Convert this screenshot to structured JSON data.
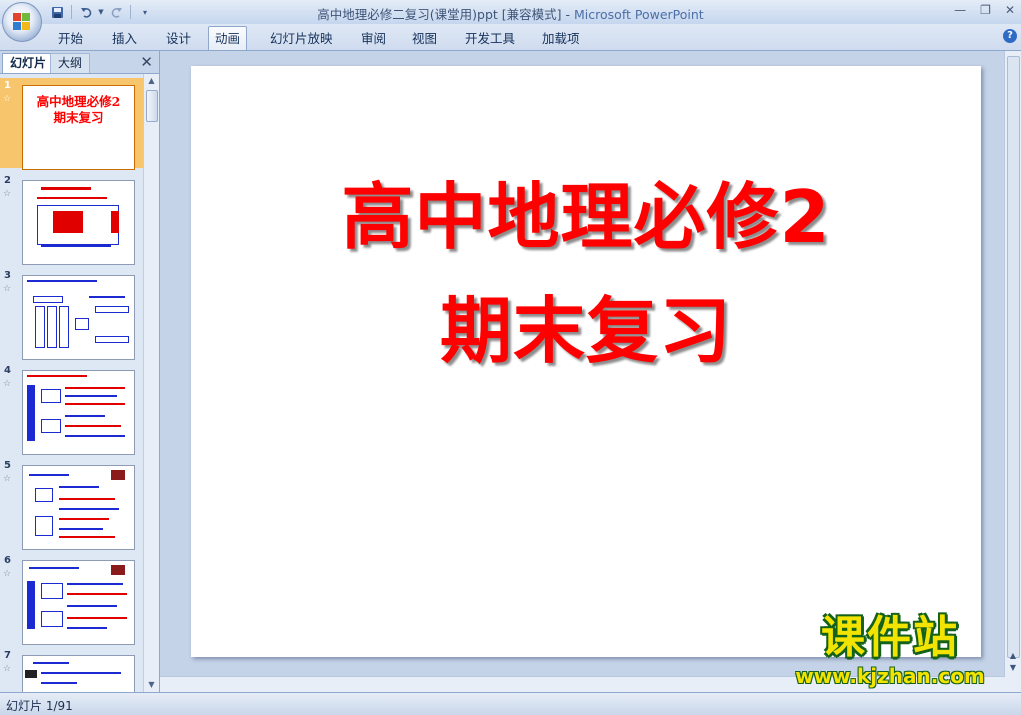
{
  "window": {
    "title": "高中地理必修二复习(课堂用)ppt [兼容模式]",
    "app_name": "Microsoft PowerPoint",
    "separator": " - "
  },
  "quick_access": {
    "icons": [
      "save-icon",
      "undo-icon",
      "redo-icon",
      "customize-icon"
    ]
  },
  "ribbon": {
    "tabs": [
      {
        "label": "开始"
      },
      {
        "label": "插入"
      },
      {
        "label": "设计"
      },
      {
        "label": "动画"
      },
      {
        "label": "幻灯片放映"
      },
      {
        "label": "审阅"
      },
      {
        "label": "视图"
      },
      {
        "label": "开发工具"
      },
      {
        "label": "加载项"
      }
    ],
    "active_tab": "动画",
    "help_label": "?"
  },
  "left_pane": {
    "tabs": [
      {
        "label": "幻灯片"
      },
      {
        "label": "大纲"
      }
    ],
    "active_tab": "幻灯片",
    "close_label": "✕",
    "slides": [
      {
        "number": "1",
        "title": "高中地理必修2\n期末复习",
        "selected": true
      },
      {
        "number": "2",
        "title": "",
        "selected": false
      },
      {
        "number": "3",
        "title": "",
        "selected": false
      },
      {
        "number": "4",
        "title": "",
        "selected": false
      },
      {
        "number": "5",
        "title": "",
        "selected": false
      },
      {
        "number": "6",
        "title": "",
        "selected": false
      },
      {
        "number": "7",
        "title": "",
        "selected": false
      }
    ],
    "star_glyph": "☆"
  },
  "slide": {
    "title_line1": "高中地理必修2",
    "title_line2": "期末复习",
    "title_color": "#ff0000"
  },
  "watermark": {
    "brand": "课件站",
    "url": "www.kjzhan.com"
  },
  "status_bar": {
    "slide_indicator": "幻灯片 1/91"
  },
  "colors": {
    "accent": "#2f6bc4",
    "selection": "#f7c56b",
    "chrome": "#c9d7ea"
  }
}
